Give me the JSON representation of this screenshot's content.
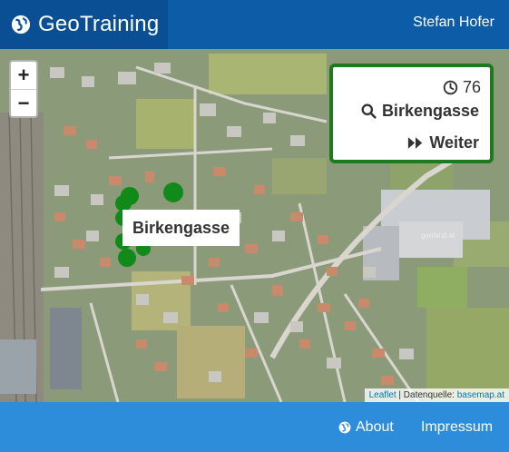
{
  "header": {
    "brand": "GeoTraining",
    "user": "Stefan Hofer"
  },
  "map": {
    "zoom_in": "+",
    "zoom_out": "−",
    "task": {
      "timer": "76",
      "target": "Birkengasse",
      "next": "Weiter"
    },
    "street_label": "Birkengasse",
    "watermark": "geoland.at",
    "attribution": {
      "leaflet": "Leaflet",
      "separator": " | Datenquelle: ",
      "source": "basemap.at"
    },
    "colors": {
      "street_highlight": "#118a1a",
      "task_border": "#1f7a1f"
    }
  },
  "footer": {
    "about": "About",
    "impressum": "Impressum"
  },
  "colors": {
    "header": "#0d5ca8",
    "brand": "#0a4f94",
    "footer": "#2e8ddb"
  }
}
